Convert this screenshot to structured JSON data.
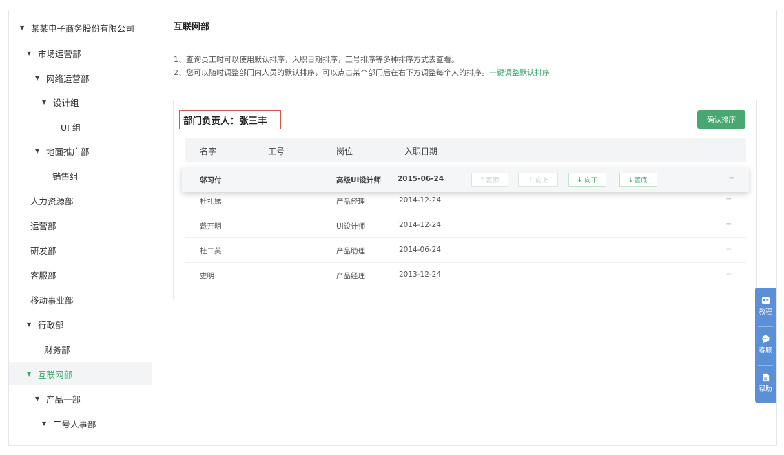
{
  "sidebar": {
    "items": [
      {
        "label": "某某电子商务股份有限公司",
        "caret": true
      },
      {
        "label": "市场运营部",
        "caret": true
      },
      {
        "label": "网络运营部",
        "caret": true
      },
      {
        "label": "设计组",
        "caret": true
      },
      {
        "label": "UI 组",
        "caret": false
      },
      {
        "label": "地面推广部",
        "caret": true
      },
      {
        "label": "销售组",
        "caret": false
      },
      {
        "label": "人力资源部",
        "caret": false
      },
      {
        "label": "运营部",
        "caret": false
      },
      {
        "label": "研发部",
        "caret": false
      },
      {
        "label": "客服部",
        "caret": false
      },
      {
        "label": "移动事业部",
        "caret": false
      },
      {
        "label": "行政部",
        "caret": true
      },
      {
        "label": "财务部",
        "caret": false
      },
      {
        "label": "互联网部",
        "caret": true,
        "active": true
      },
      {
        "label": "产品一部",
        "caret": true
      },
      {
        "label": "二号人事部",
        "caret": true
      }
    ]
  },
  "main": {
    "title": "互联网部",
    "note1": "1、查询员工时可以使用默认排序，入职日期排序，工号排序等多种排序方式去查看。",
    "note2": "2、您可以随时调整部门内人员的默认排序，可以点击某个部门后在右下方调整每个人的排序。",
    "note2_link": "一键调整默认排序",
    "manager": "部门负责人：张三丰",
    "confirm_button": "确认排序",
    "columns": {
      "name": "名字",
      "id": "工号",
      "position": "岗位",
      "date": "入职日期"
    },
    "rows": [
      {
        "name": "邬习付",
        "position": "高级UI设计师",
        "date": "2015-06-24"
      },
      {
        "name": "杜礼娣",
        "position": "产品经理",
        "date": "2014-12-24"
      },
      {
        "name": "戴开明",
        "position": "UI设计师",
        "date": "2014-12-24"
      },
      {
        "name": "杜二英",
        "position": "产品助理",
        "date": "2014-06-24"
      },
      {
        "name": "史明",
        "position": "产品经理",
        "date": "2013-12-24"
      }
    ],
    "actions": {
      "top": "置顶",
      "up": "向上",
      "down": "向下",
      "bottom": "置底"
    }
  },
  "float_help": {
    "tutorial": "教程",
    "service": "客服",
    "help": "帮助"
  },
  "colors": {
    "accent": "#3aa66e",
    "float_bg": "#5b8fd8",
    "manager_border": "#d9534f"
  },
  "icons": {
    "caret": "caret-down-icon",
    "drag": "drag-handle-icon",
    "tutorial": "tutorial-icon",
    "service": "chat-icon",
    "help": "document-icon"
  }
}
